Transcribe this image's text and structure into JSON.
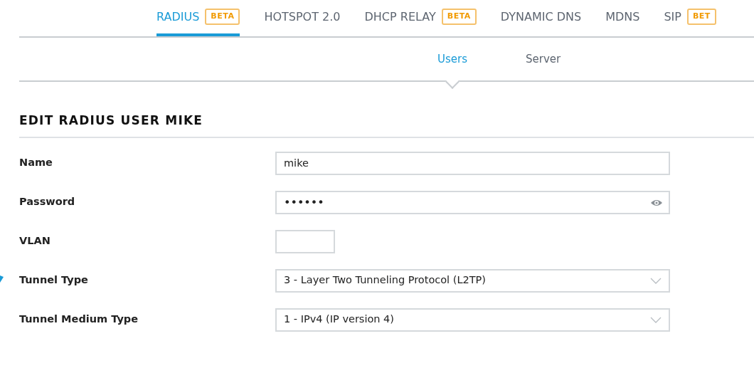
{
  "tabs": [
    {
      "label": "RADIUS",
      "badge": "BETA",
      "selected": true
    },
    {
      "label": "HOTSPOT 2.0",
      "selected": false
    },
    {
      "label": "DHCP RELAY",
      "badge": "BETA",
      "selected": false
    },
    {
      "label": "DYNAMIC DNS",
      "selected": false
    },
    {
      "label": "MDNS",
      "selected": false
    },
    {
      "label": "SIP",
      "badge": "BET",
      "selected": false
    }
  ],
  "subtabs": [
    {
      "label": "Users",
      "selected": true
    },
    {
      "label": "Server",
      "selected": false
    }
  ],
  "heading": "EDIT RADIUS USER MIKE",
  "fields": [
    {
      "kind": "text",
      "label": "Name",
      "value": "mike"
    },
    {
      "kind": "password",
      "label": "Password",
      "value": "••••••"
    },
    {
      "kind": "short",
      "label": "VLAN"
    },
    {
      "kind": "select",
      "label": "Tunnel Type",
      "value": "3 - Layer Two Tunneling Protocol (L2TP)"
    },
    {
      "kind": "select",
      "label": "Tunnel Medium Type",
      "value": "1 - IPv4 (IP version 4)"
    }
  ]
}
